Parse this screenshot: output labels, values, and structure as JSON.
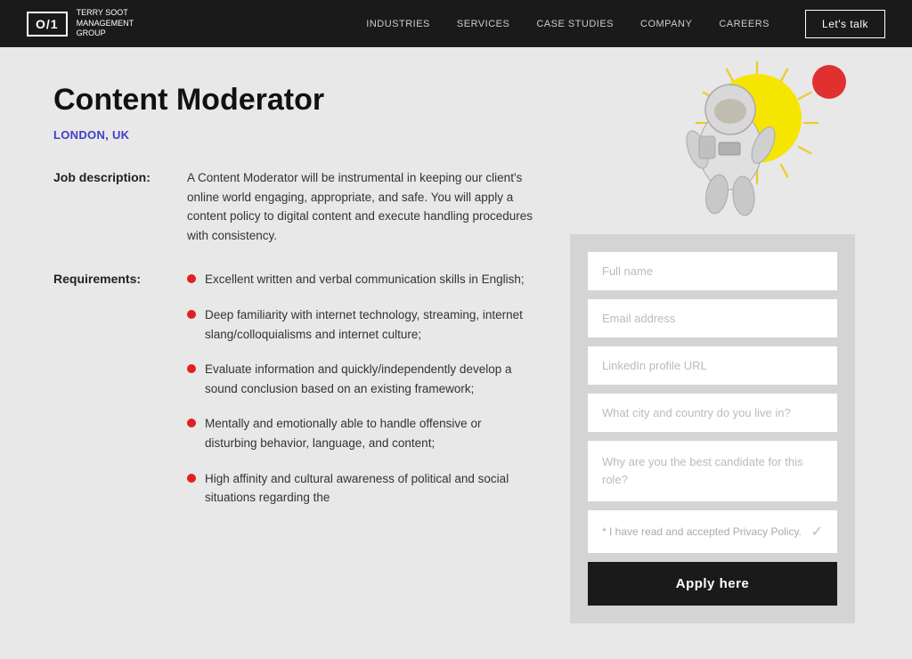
{
  "header": {
    "logo_text": "O/1",
    "company_name": "TERRY SOOT\nMANAGEMENT\nGROUP",
    "nav_items": [
      {
        "label": "INDUSTRIES",
        "href": "#"
      },
      {
        "label": "SERVICES",
        "href": "#"
      },
      {
        "label": "CASE STUDIES",
        "href": "#"
      },
      {
        "label": "COMPANY",
        "href": "#"
      },
      {
        "label": "CAREERS",
        "href": "#"
      }
    ],
    "cta_button": "Let's talk"
  },
  "job": {
    "title": "Content Moderator",
    "location": "LONDON, UK",
    "description_label": "Job description:",
    "description_text": "A Content Moderator will be instrumental in keeping our client's online world engaging, appropriate, and safe. You will apply a content policy to digital content and execute handling procedures with consistency.",
    "requirements_label": "Requirements:",
    "requirements": [
      "Excellent written and verbal communication skills in English;",
      "Deep familiarity with internet technology, streaming, internet slang/colloquialisms and internet culture;",
      "Evaluate information and quickly/independently develop a sound conclusion based on an existing framework;",
      "Mentally and emotionally able to handle offensive or disturbing behavior, language, and content;",
      "High affinity and cultural awareness of political and social situations regarding the"
    ]
  },
  "form": {
    "full_name_placeholder": "Full name",
    "email_placeholder": "Email address",
    "linkedin_placeholder": "LinkedIn profile URL",
    "city_placeholder": "What city and country do you live in?",
    "candidate_placeholder": "Why are you the best candidate for this role?",
    "privacy_text": "* I have read and accepted Privacy Policy.",
    "submit_label": "Apply here"
  }
}
